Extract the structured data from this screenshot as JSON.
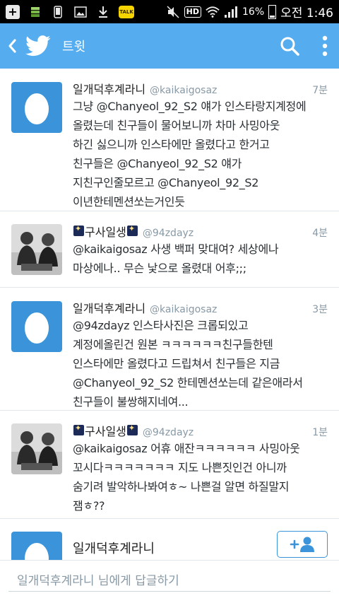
{
  "status_bar": {
    "battery": "16%",
    "time": "오전 1:46",
    "hd": "HD",
    "talk": "TALK"
  },
  "header": {
    "title": "트윗"
  },
  "tweets": [
    {
      "name": "일개덕후계라니",
      "handle": "@kaikaigosaz",
      "time": "7분",
      "text": "그냥 @Chanyeol_92_S2 얘가 인스타랑지계정에\n올렸는데 친구들이 물어보니까 차마 사밍아웃\n하긴 싫으니까 인스타에만 올렸다고 한거고\n친구들은 @Chanyeol_92_S2 얘가\n지친구인줄모르고 @Chanyeol_92_S2\n이년한테멘션쏘는거인듯",
      "avatar": "egg"
    },
    {
      "name": "구사일생",
      "handle": "@94zdayz",
      "time": "4분",
      "text": "@kaikaigosaz 사생 백퍼 맞대여? 세상에나\n마상에나.. 무슨 낯으로 올렸대 어후;;;",
      "avatar": "photo"
    },
    {
      "name": "일개덕후계라니",
      "handle": "@kaikaigosaz",
      "time": "3분",
      "text": "@94zdayz 인스타사진은 크롭되있고\n계정에올린건 원본 ㅋㅋㅋㅋㅋㅋ친구들한텐\n인스타에만 올렸다고 드립쳐서 친구들은 지금\n@Chanyeol_92_S2 한테멘션쏘는데 같은애라서\n친구들이 불쌍해지네여...",
      "avatar": "egg"
    },
    {
      "name": "구사일생",
      "handle": "@94zdayz",
      "time": "1분",
      "text": "@kaikaigosaz 어휴 애잔ㅋㅋㅋㅋㅋㅋ 사밍아웃\n꼬시다ㅋㅋㅋㅋㅋㅋㅋ 지도 나쁜짓인건 아니까\n숨기려 발악하나봐여ㅎ~ 나쁜걸 알면 하질말지\n잼ㅎ??",
      "avatar": "photo"
    }
  ],
  "user_card": {
    "name": "일개덕후계라니"
  },
  "reply": {
    "placeholder": "일개덕후계라니 님에게 답글하기"
  },
  "colors": {
    "accent": "#55acee",
    "egg_bg": "#3b94d9",
    "meta_gray": "#8899a6"
  }
}
